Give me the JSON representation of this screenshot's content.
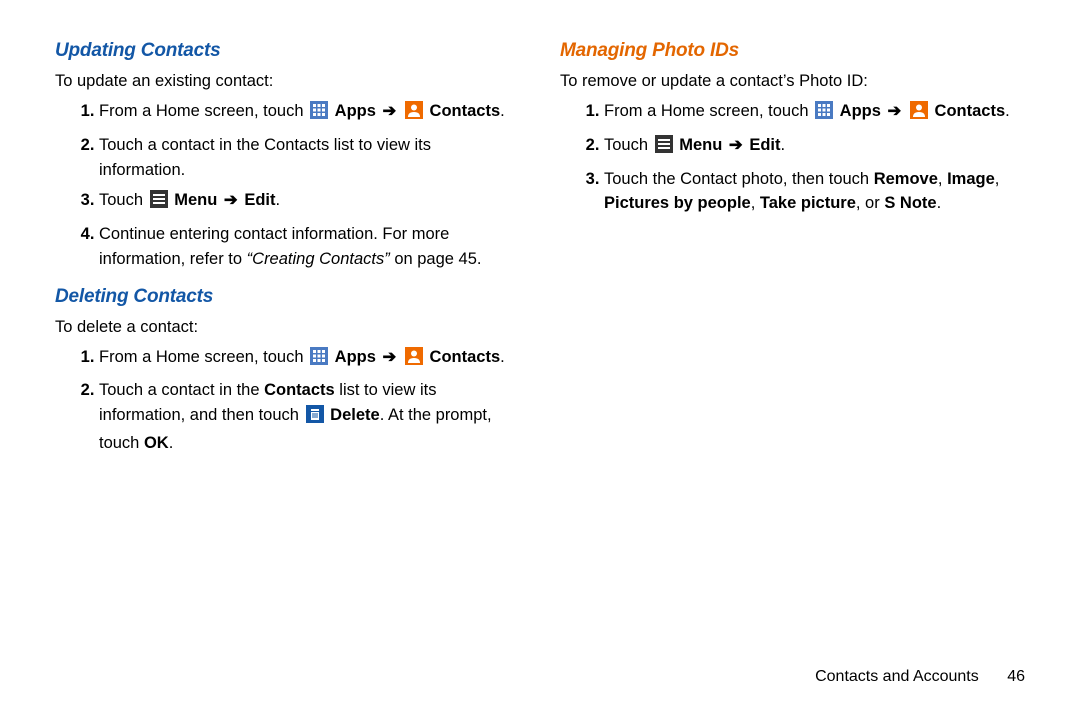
{
  "arrow": "➔",
  "icons": {
    "apps_label": "Apps",
    "contacts_label": "Contacts",
    "menu_label": "Menu",
    "delete_label": "Delete",
    "edit_label": "Edit"
  },
  "col1": {
    "updating": {
      "heading": "Updating Contacts",
      "intro": "To update an existing contact:",
      "step1_pre": "From a Home screen, touch ",
      "step2": "Touch a contact in the Contacts list to view its information.",
      "step3_pre": "Touch ",
      "step4": "Continue entering contact information. For more information, refer to ",
      "step4_ref": "“Creating Contacts”",
      "step4_post": " on page 45."
    },
    "deleting": {
      "heading": "Deleting Contacts",
      "intro": "To delete a contact:",
      "step1_pre": "From a Home screen, touch ",
      "step2_a": "Touch a contact in the ",
      "step2_b": "Contacts",
      "step2_c": " list to view its information, and then touch ",
      "step2_d": ". At the prompt, touch ",
      "step2_e": "OK",
      "period": "."
    }
  },
  "col2": {
    "managing": {
      "heading": "Managing Photo IDs",
      "intro": "To remove or update a contact’s Photo ID:",
      "step1_pre": "From a Home screen, touch ",
      "step2_pre": "Touch ",
      "step3_a": "Touch the Contact photo, then touch ",
      "step3_b": "Remove",
      "step3_c": ", ",
      "step3_d": "Image",
      "step3_e": ", ",
      "step3_f": "Pictures by people",
      "step3_g": ", ",
      "step3_h": "Take picture",
      "step3_i": ", or ",
      "step3_j": "S Note",
      "period": "."
    }
  },
  "footer": {
    "section": "Contacts and Accounts",
    "page": "46"
  }
}
